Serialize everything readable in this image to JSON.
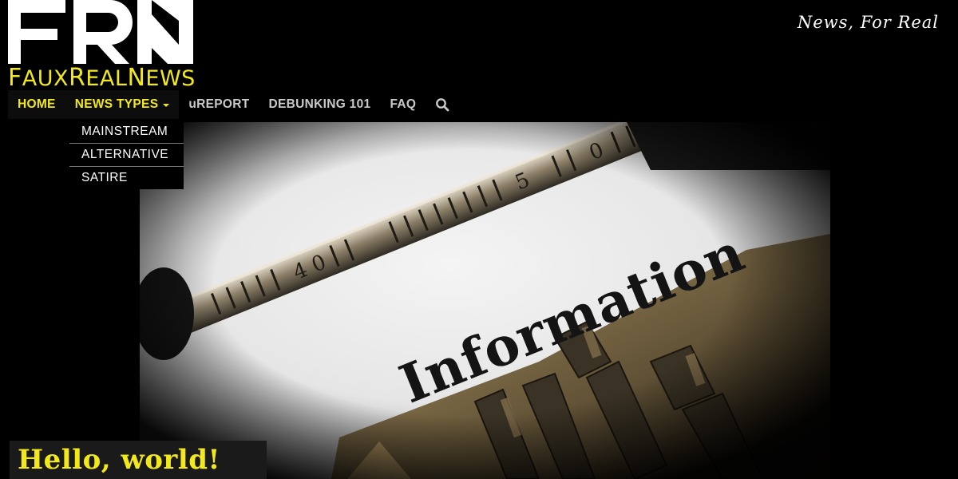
{
  "brand": {
    "logo_letters": "FRN",
    "name_parts": [
      "F",
      "AUX",
      "R",
      "EAL",
      "N",
      "EWS"
    ],
    "tagline": "News, For Real",
    "accent": "#f2e81a"
  },
  "nav": {
    "items": [
      {
        "label": "HOME"
      },
      {
        "label": "NEWS TYPES"
      },
      {
        "label": "uREPORT"
      },
      {
        "label": "DEBUNKING 101"
      },
      {
        "label": "FAQ"
      }
    ],
    "search_icon": "search-icon"
  },
  "dropdown": {
    "items": [
      {
        "label": "MAINSTREAM"
      },
      {
        "label": "ALTERNATIVE"
      },
      {
        "label": "SATIRE"
      }
    ]
  },
  "hero": {
    "word": "Information",
    "scale_digits": [
      "4",
      "0",
      "5",
      "0"
    ]
  },
  "banner": {
    "text": "Hello, world!"
  }
}
